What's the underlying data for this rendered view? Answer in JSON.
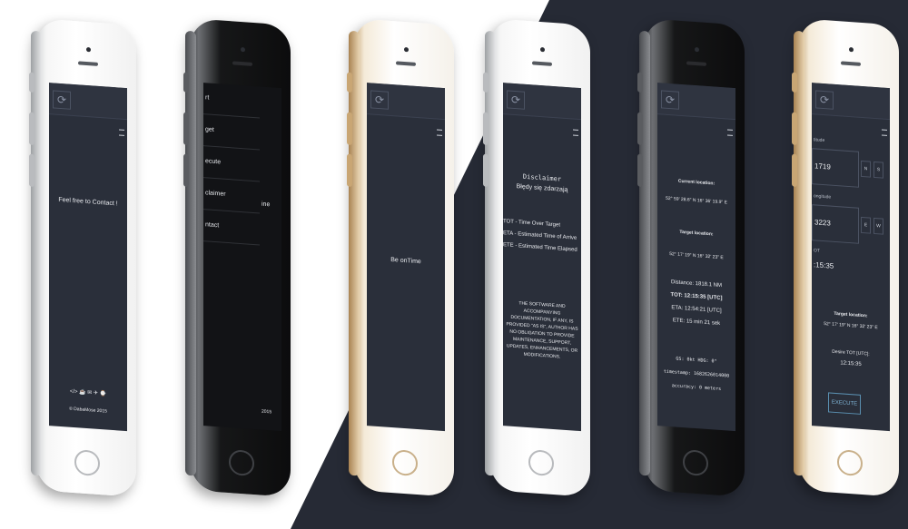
{
  "screens": {
    "contact": {
      "message": "Feel free to Contact !",
      "footer_icons": "</> ☕ ✉ ✈ ⌚",
      "copyright": "© DabaMose 2015"
    },
    "menu": {
      "items": [
        "rt",
        "get",
        "ecute",
        "claimer",
        "ntact"
      ],
      "peek_text": "ine",
      "copyright": "2015"
    },
    "online": {
      "message": "Be onTime"
    },
    "disclaimer": {
      "title": "Disclaimer",
      "subtitle": "Błędy się zdarzają",
      "tot": "TOT - Time Over Target",
      "eta": "ETA - Estimated Time of Arrive",
      "ete": "ETE - Estimated Time Elapsed",
      "legal": "THE SOFTWARE AND ACCOMPANYING DOCUMENTATION, IF ANY, IS PROVIDED \"AS IS\", AUTHOR HAS NO OBLIGATION TO PROVIDE MAINTENANCE, SUPPORT, UPDATES, ENHANCEMENTS, OR MODIFICATIONS."
    },
    "status": {
      "current_label": "Current location:",
      "current_value": "52° 59' 28.6\" N 16° 36' 19.9\" E",
      "target_label": "Target location:",
      "target_value": "52° 17' 19\" N 16° 32' 23\" E",
      "distance": "Distance: 1818.1 NM",
      "tot": "TOT: 12:15:35 [UTC]",
      "eta": "ETA: 12:54:21 [UTC]",
      "ete": "ETE: 15 min 21 sek",
      "gs": "GS: 0kt HDG: 0°",
      "timestamp": "timestamp: 1682626014000",
      "accuracy": "accuracy: 0 meters"
    },
    "execute": {
      "lat_label": "titude",
      "lat_value": "1719",
      "lat_ns_n": "N",
      "lat_ns_s": "S",
      "lon_label": "ongitude",
      "lon_value": "3223",
      "lon_e": "E",
      "lon_w": "W",
      "tot_label": "OT",
      "tot_value": ":15:35",
      "target_label": "Target location:",
      "target_value": "52° 17' 19\" N 16° 32' 23\" E",
      "desire_label": "Desire TOT [UTC]:",
      "desire_value": "12:15:35",
      "execute_button": "EXECUTE"
    }
  },
  "colors": {
    "screen_bg": "#2a2f3a",
    "dark_bg": "#262a35",
    "accent": "#7fb4d6"
  },
  "icons": [
    "refresh-icon",
    "menu-icon",
    "emoji-icon"
  ]
}
